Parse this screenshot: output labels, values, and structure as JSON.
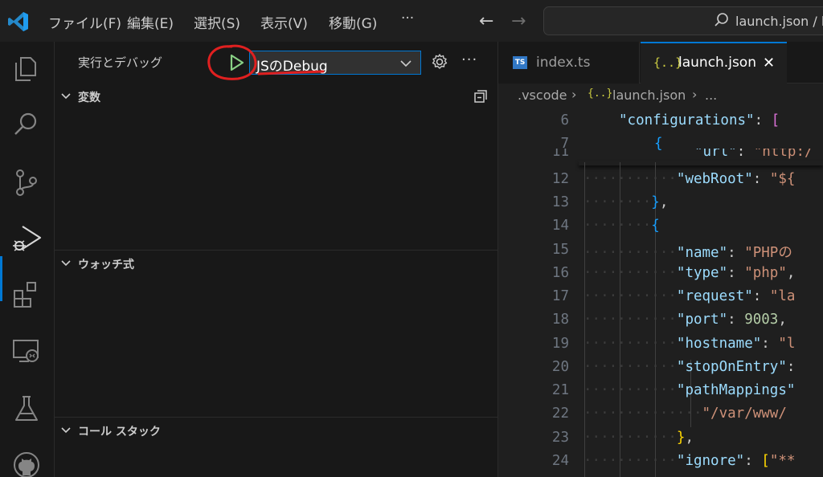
{
  "menu": {
    "file": "ファイル(F)",
    "edit": "編集(E)",
    "selection": "選択(S)",
    "view": "表示(V)",
    "go": "移動(G)",
    "more": "···"
  },
  "search": {
    "text": "launch.json / la"
  },
  "sidebar": {
    "title": "実行とデバッグ",
    "config_selected": "JSのDebug",
    "sections": {
      "variables": "変数",
      "watch": "ウォッチ式",
      "callstack": "コール スタック"
    }
  },
  "tabs": [
    {
      "label": "index.ts",
      "icon": "TS"
    },
    {
      "label": "launch.json",
      "icon": "{..}"
    }
  ],
  "breadcrumb": [
    ".vscode",
    "launch.json",
    "..."
  ],
  "code": [
    {
      "num": "6",
      "text": "\"configurations\": ["
    },
    {
      "num": "7",
      "text": "{"
    },
    {
      "num": "11",
      "text": "\"url\": \"http:/"
    },
    {
      "num": "12",
      "text": "\"webRoot\": \"${"
    },
    {
      "num": "13",
      "text": "},"
    },
    {
      "num": "14",
      "text": "{"
    },
    {
      "num": "15",
      "text": "\"name\": \"PHPの"
    },
    {
      "num": "16",
      "text": "\"type\": \"php\","
    },
    {
      "num": "17",
      "text": "\"request\": \"la"
    },
    {
      "num": "18",
      "text": "\"port\": 9003,"
    },
    {
      "num": "19",
      "text": "\"hostname\": \"l"
    },
    {
      "num": "20",
      "text": "\"stopOnEntry\":"
    },
    {
      "num": "21",
      "text": "\"pathMappings\""
    },
    {
      "num": "22",
      "text": "\"/var/www/"
    },
    {
      "num": "23",
      "text": "},"
    },
    {
      "num": "24",
      "text": "\"ignore\": [\"**"
    }
  ],
  "colors": {
    "accent": "#0078d4",
    "annotation": "#e02020",
    "play": "#89d185"
  }
}
